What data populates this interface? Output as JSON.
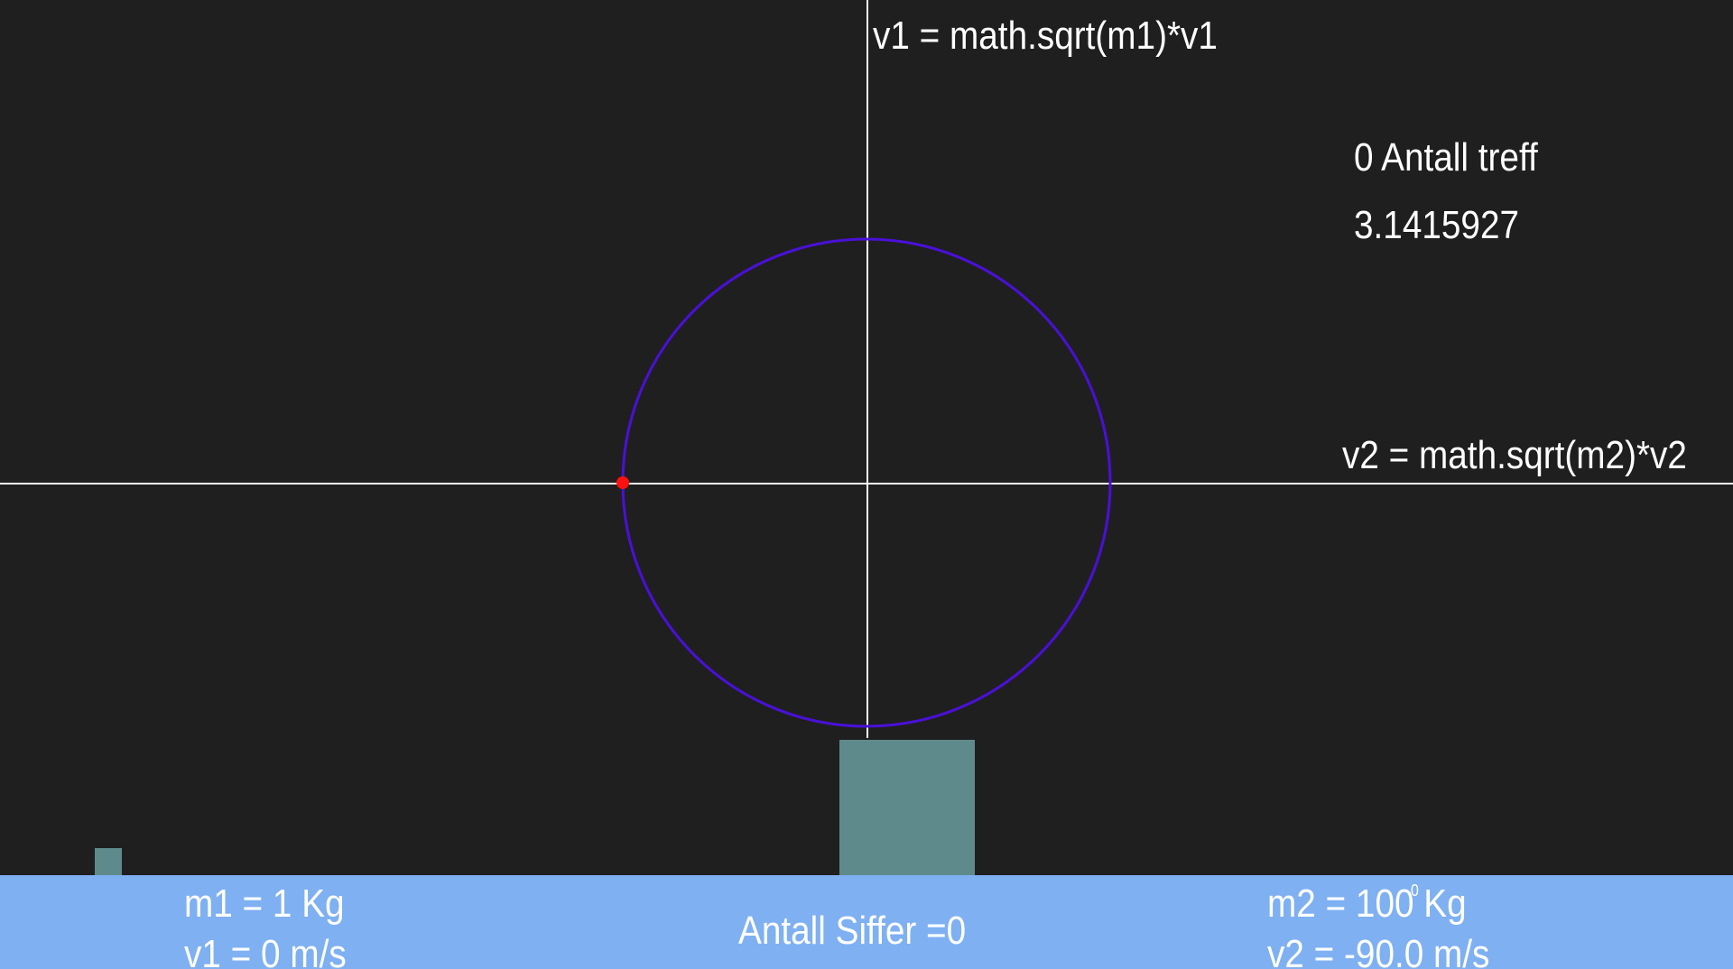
{
  "labels": {
    "v1_axis_label": "v1 = math.sqrt(m1)*v1",
    "v2_axis_label": "v2 = math.sqrt(m2)*v2",
    "hit_count_text": "0 Antall treff",
    "pi_estimate": "3.1415927"
  },
  "floor": {
    "m1_text": "m1 = 1 Kg",
    "v1_text": "v1 =  0 m/s",
    "digits_text": "Antall Siffer =0",
    "m2_text": "m2 = 100 Kg",
    "m2_marker": "0",
    "v2_text": "v2 =  -90.0 m/s"
  },
  "simulation": {
    "m1_kg": 1,
    "m2_kg": 100,
    "v1_ms": 0,
    "v2_ms": -90.0,
    "hits": 0,
    "digits": 0
  },
  "colors": {
    "background": "#1f1f1f",
    "axes": "#ffffff",
    "circle": "#4a10d8",
    "state_point": "#ff1010",
    "block": "#5f8a8b",
    "floor": "#7fb0f2",
    "text": "#ffffff"
  }
}
